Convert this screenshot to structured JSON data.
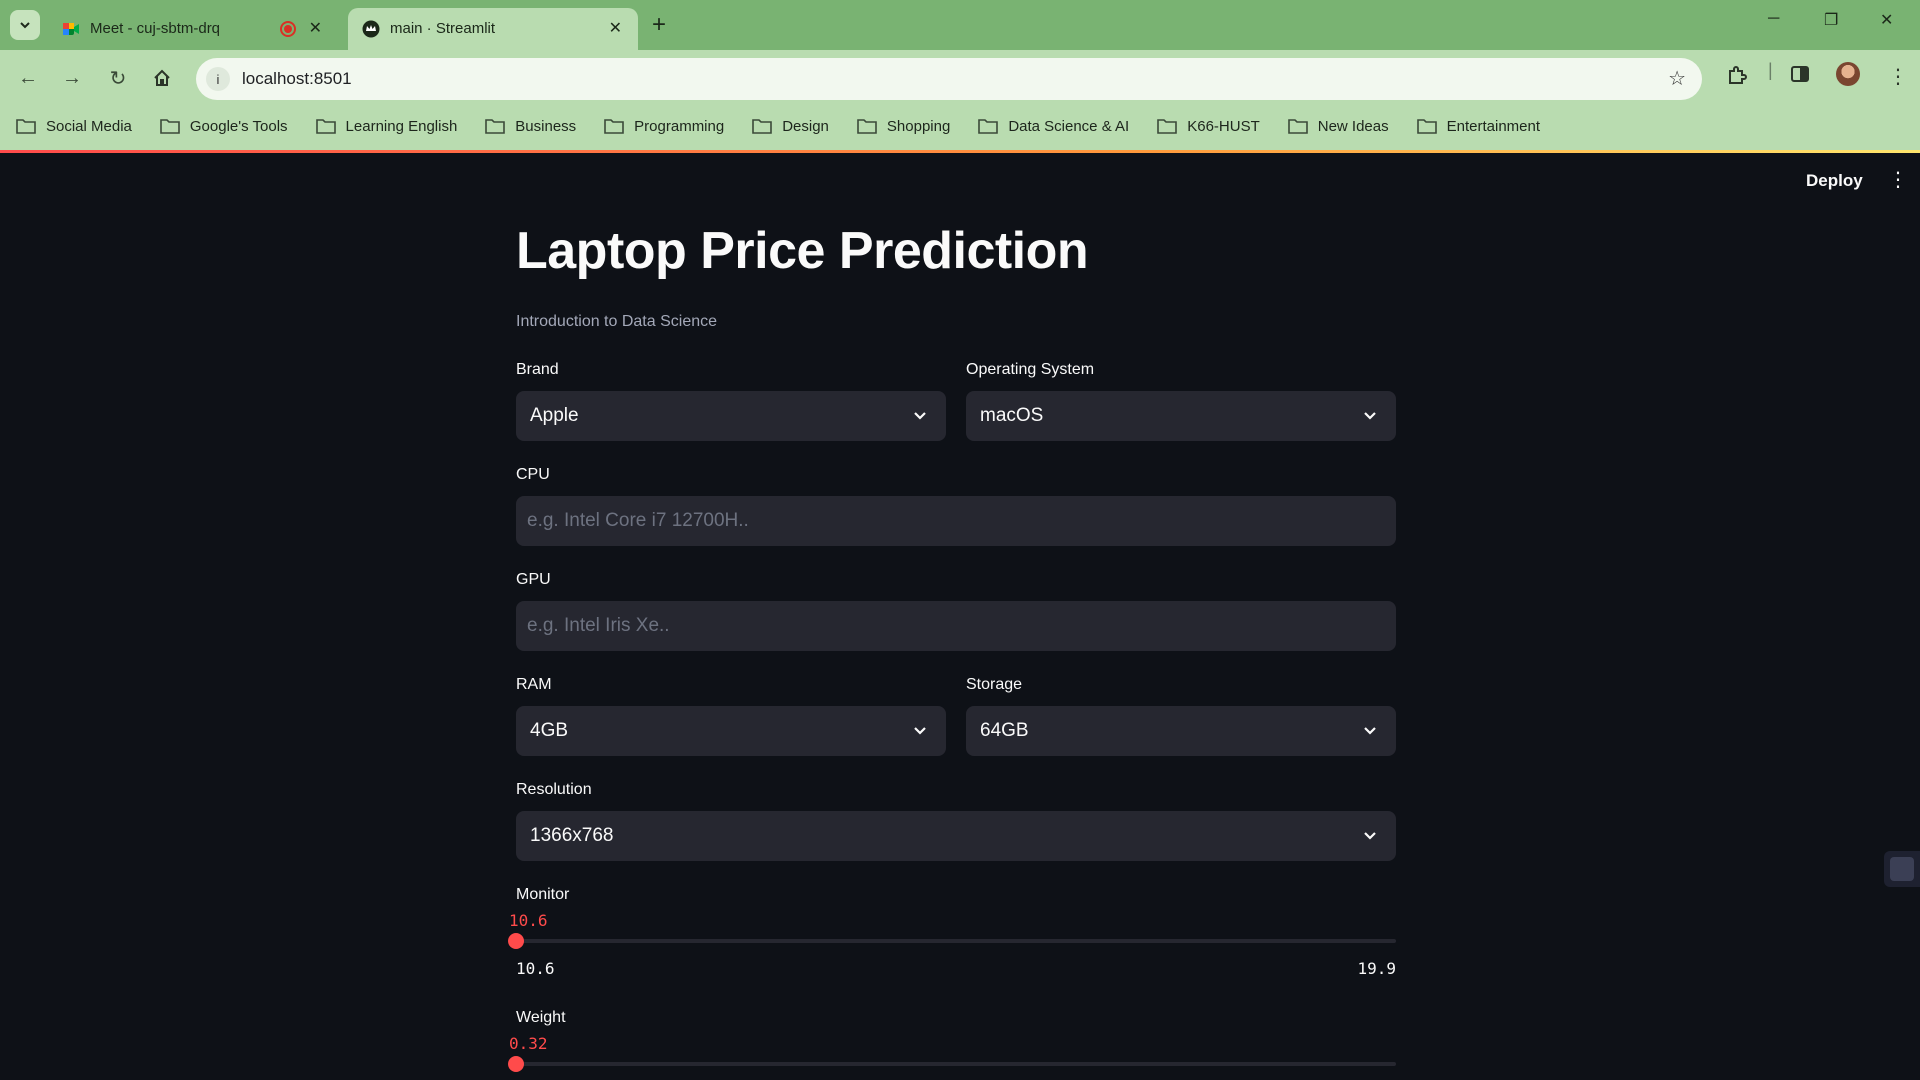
{
  "browser": {
    "tabs": [
      {
        "title": "Meet - cuj-sbtm-drq",
        "recording": true
      },
      {
        "title": "main · Streamlit"
      }
    ],
    "url": "localhost:8501",
    "bookmarks": [
      "Social Media",
      "Google's Tools",
      "Learning English",
      "Business",
      "Programming",
      "Design",
      "Shopping",
      "Data Science & AI",
      "K66-HUST",
      "New Ideas",
      "Entertainment"
    ]
  },
  "header": {
    "deploy_label": "Deploy"
  },
  "app": {
    "title": "Laptop Price Prediction",
    "caption": "Introduction to Data Science",
    "brand": {
      "label": "Brand",
      "value": "Apple"
    },
    "os": {
      "label": "Operating System",
      "value": "macOS"
    },
    "cpu": {
      "label": "CPU",
      "placeholder": "e.g. Intel Core i7 12700H.."
    },
    "gpu": {
      "label": "GPU",
      "placeholder": "e.g. Intel Iris Xe.."
    },
    "ram": {
      "label": "RAM",
      "value": "4GB"
    },
    "storage": {
      "label": "Storage",
      "value": "64GB"
    },
    "resolution": {
      "label": "Resolution",
      "value": "1366x768"
    },
    "monitor": {
      "label": "Monitor",
      "value": "10.6",
      "min": "10.6",
      "max": "19.9",
      "fraction": 0
    },
    "weight": {
      "label": "Weight",
      "value": "0.32",
      "fraction": 0
    }
  },
  "colors": {
    "primary": "#ff4b4b",
    "background": "#0e1117",
    "widget_bg": "#262730",
    "tabstrip": "#79b372"
  }
}
